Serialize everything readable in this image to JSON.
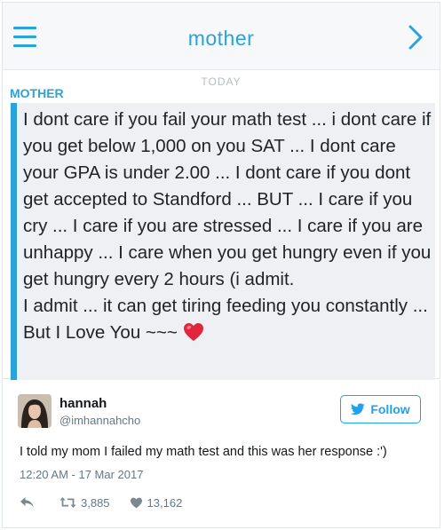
{
  "chat": {
    "title": "mother",
    "menu_icon": "hamburger-menu-icon",
    "next_icon": "chevron-right-icon",
    "accent_color": "#2aa3d8",
    "day_label": "TODAY",
    "sender": "MOTHER",
    "message_paragraphs": [
      "I dont care if you fail your math test ... i dont care if you get below 1,000 on you SAT ... I dont care your GPA is under 2.00 ... I dont care if you dont get accepted to Standford ... BUT ... I care if you cry ... I care if you are stressed ... I care if you are unhappy ... I care when you get hungry even if you get hungry every 2 hours  (i admit.",
      "I admit ... it can get tiring feeding you constantly  ... But I Love You ~~~"
    ],
    "emoji": "red-heart-emoji"
  },
  "tweet": {
    "display_name": "hannah",
    "handle": "@imhannahcho",
    "follow_label": "Follow",
    "follow_color": "#1da1f2",
    "text": "I told my mom I failed my math test and this was her response :')",
    "timestamp": "12:20 AM - 17 Mar 2017",
    "retweets": "3,885",
    "likes": "13,162",
    "icons": [
      "reply-icon",
      "retweet-icon",
      "heart-icon",
      "twitter-bird-icon"
    ]
  }
}
